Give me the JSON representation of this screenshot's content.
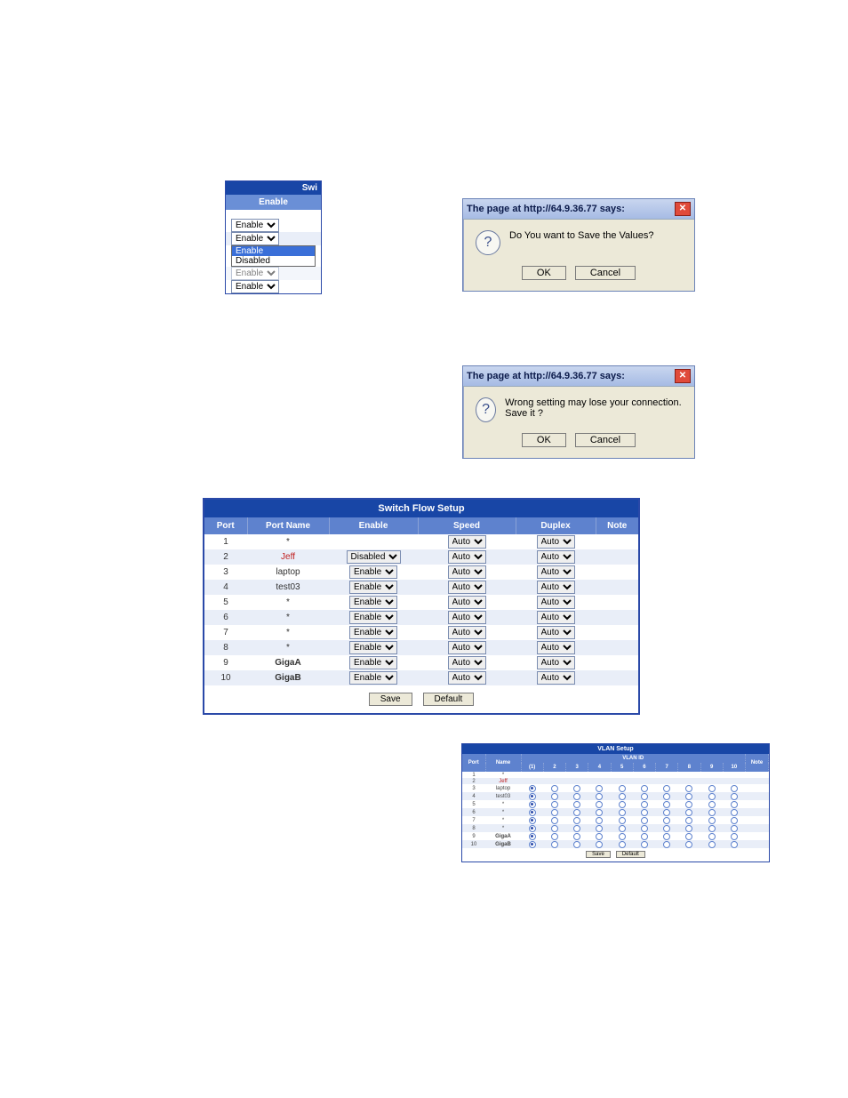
{
  "enable_snippet": {
    "header": "Swi",
    "column": "Enable",
    "rows": [
      "Enable",
      "Enable"
    ],
    "open": {
      "options": [
        "Enable",
        "Disabled"
      ],
      "selected": "Enable"
    },
    "after": [
      "Enable",
      "Enable"
    ]
  },
  "dialog1": {
    "title": "The page at http://64.9.36.77 says:",
    "message": "Do You want to Save the Values?",
    "ok": "OK",
    "cancel": "Cancel"
  },
  "dialog2": {
    "title": "The page at http://64.9.36.77 says:",
    "message": "Wrong setting may lose your connection. Save it ?",
    "ok": "OK",
    "cancel": "Cancel"
  },
  "flow": {
    "title": "Switch Flow Setup",
    "headers": {
      "port": "Port",
      "name": "Port Name",
      "enable": "Enable",
      "speed": "Speed",
      "duplex": "Duplex",
      "note": "Note"
    },
    "rows": [
      {
        "port": "1",
        "name": "*",
        "enable": "",
        "speed": "Auto",
        "duplex": "Auto",
        "note": ""
      },
      {
        "port": "2",
        "name": "Jeff",
        "name_red": true,
        "enable": "Disabled",
        "speed": "Auto",
        "duplex": "Auto",
        "note": ""
      },
      {
        "port": "3",
        "name": "laptop",
        "enable": "Enable",
        "speed": "Auto",
        "duplex": "Auto",
        "note": ""
      },
      {
        "port": "4",
        "name": "test03",
        "enable": "Enable",
        "speed": "Auto",
        "duplex": "Auto",
        "note": ""
      },
      {
        "port": "5",
        "name": "*",
        "enable": "Enable",
        "speed": "Auto",
        "duplex": "Auto",
        "note": ""
      },
      {
        "port": "6",
        "name": "*",
        "enable": "Enable",
        "speed": "Auto",
        "duplex": "Auto",
        "note": ""
      },
      {
        "port": "7",
        "name": "*",
        "enable": "Enable",
        "speed": "Auto",
        "duplex": "Auto",
        "note": ""
      },
      {
        "port": "8",
        "name": "*",
        "enable": "Enable",
        "speed": "Auto",
        "duplex": "Auto",
        "note": ""
      },
      {
        "port": "9",
        "name": "GigaA",
        "name_bold": true,
        "enable": "Enable",
        "speed": "Auto",
        "duplex": "Auto",
        "note": ""
      },
      {
        "port": "10",
        "name": "GigaB",
        "name_bold": true,
        "enable": "Enable",
        "speed": "Auto",
        "duplex": "Auto",
        "note": ""
      }
    ],
    "save": "Save",
    "default": "Default"
  },
  "vlan": {
    "title": "VLAN Setup",
    "headers": {
      "port": "Port",
      "name": "Name",
      "vlan_id": "VLAN ID",
      "note": "Note"
    },
    "vlan_cols": [
      "(1)",
      "2",
      "3",
      "4",
      "5",
      "6",
      "7",
      "8",
      "9",
      "10"
    ],
    "rows": [
      {
        "port": "1",
        "name": "*"
      },
      {
        "port": "2",
        "name": "Jeff",
        "name_red": true
      },
      {
        "port": "3",
        "name": "laptop",
        "selected": 1
      },
      {
        "port": "4",
        "name": "test03",
        "selected": 1
      },
      {
        "port": "5",
        "name": "*",
        "selected": 1
      },
      {
        "port": "6",
        "name": "*",
        "selected": 1
      },
      {
        "port": "7",
        "name": "*",
        "selected": 1
      },
      {
        "port": "8",
        "name": "*",
        "selected": 1
      },
      {
        "port": "9",
        "name": "GigaA",
        "name_bold": true,
        "selected": 1
      },
      {
        "port": "10",
        "name": "GigaB",
        "name_bold": true,
        "selected": 1
      }
    ],
    "save": "Save",
    "default": "Default"
  }
}
